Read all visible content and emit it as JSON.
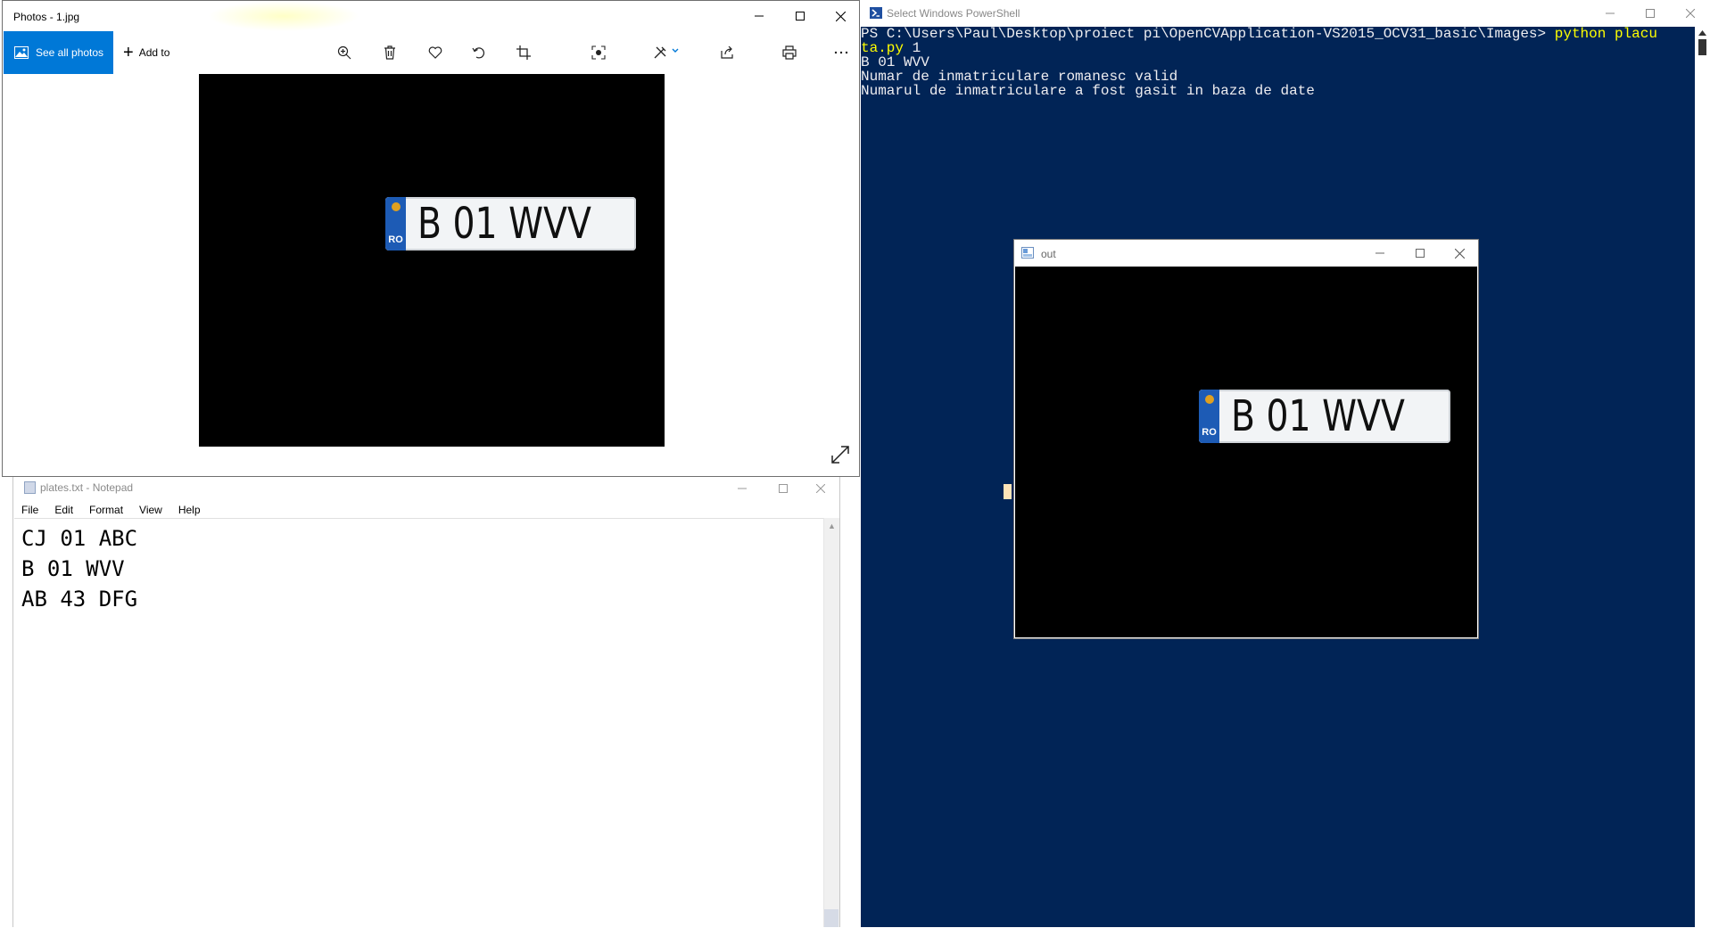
{
  "photos": {
    "title": "Photos - 1.jpg",
    "see_all_label": "See all photos",
    "add_to_label": "Add to",
    "plate_text": "B 01 WVV",
    "plate_country": "RO",
    "icons": [
      "zoom-icon",
      "delete-icon",
      "favorite-icon",
      "rotate-icon",
      "crop-icon",
      "enhance-icon",
      "edit-icon",
      "share-icon",
      "print-icon",
      "more-icon",
      "expand-icon"
    ]
  },
  "notepad": {
    "title": "plates.txt - Notepad",
    "menu": [
      "File",
      "Edit",
      "Format",
      "View",
      "Help"
    ],
    "lines": [
      "CJ 01 ABC",
      "B 01 WVV",
      "AB 43 DFG"
    ]
  },
  "powershell": {
    "title": "Select Windows PowerShell",
    "prompt": "PS C:\\Users\\Paul\\Desktop\\proiect pi\\OpenCVApplication-VS2015_OCV31_basic\\Images> ",
    "command_start": "python placu",
    "command_cont_1": "ta.py",
    "command_cont_2": " 1",
    "output": [
      "B 01 WVV",
      "Numar de inmatriculare romanesc valid",
      "Numarul de inmatriculare a fost gasit in baza de date"
    ]
  },
  "out_window": {
    "title": "out",
    "plate_text": "B 01 WVV",
    "plate_country": "RO"
  },
  "colors": {
    "powershell_bg": "#012456",
    "accent": "#0078d7",
    "command_highlight": "#ffff00"
  }
}
